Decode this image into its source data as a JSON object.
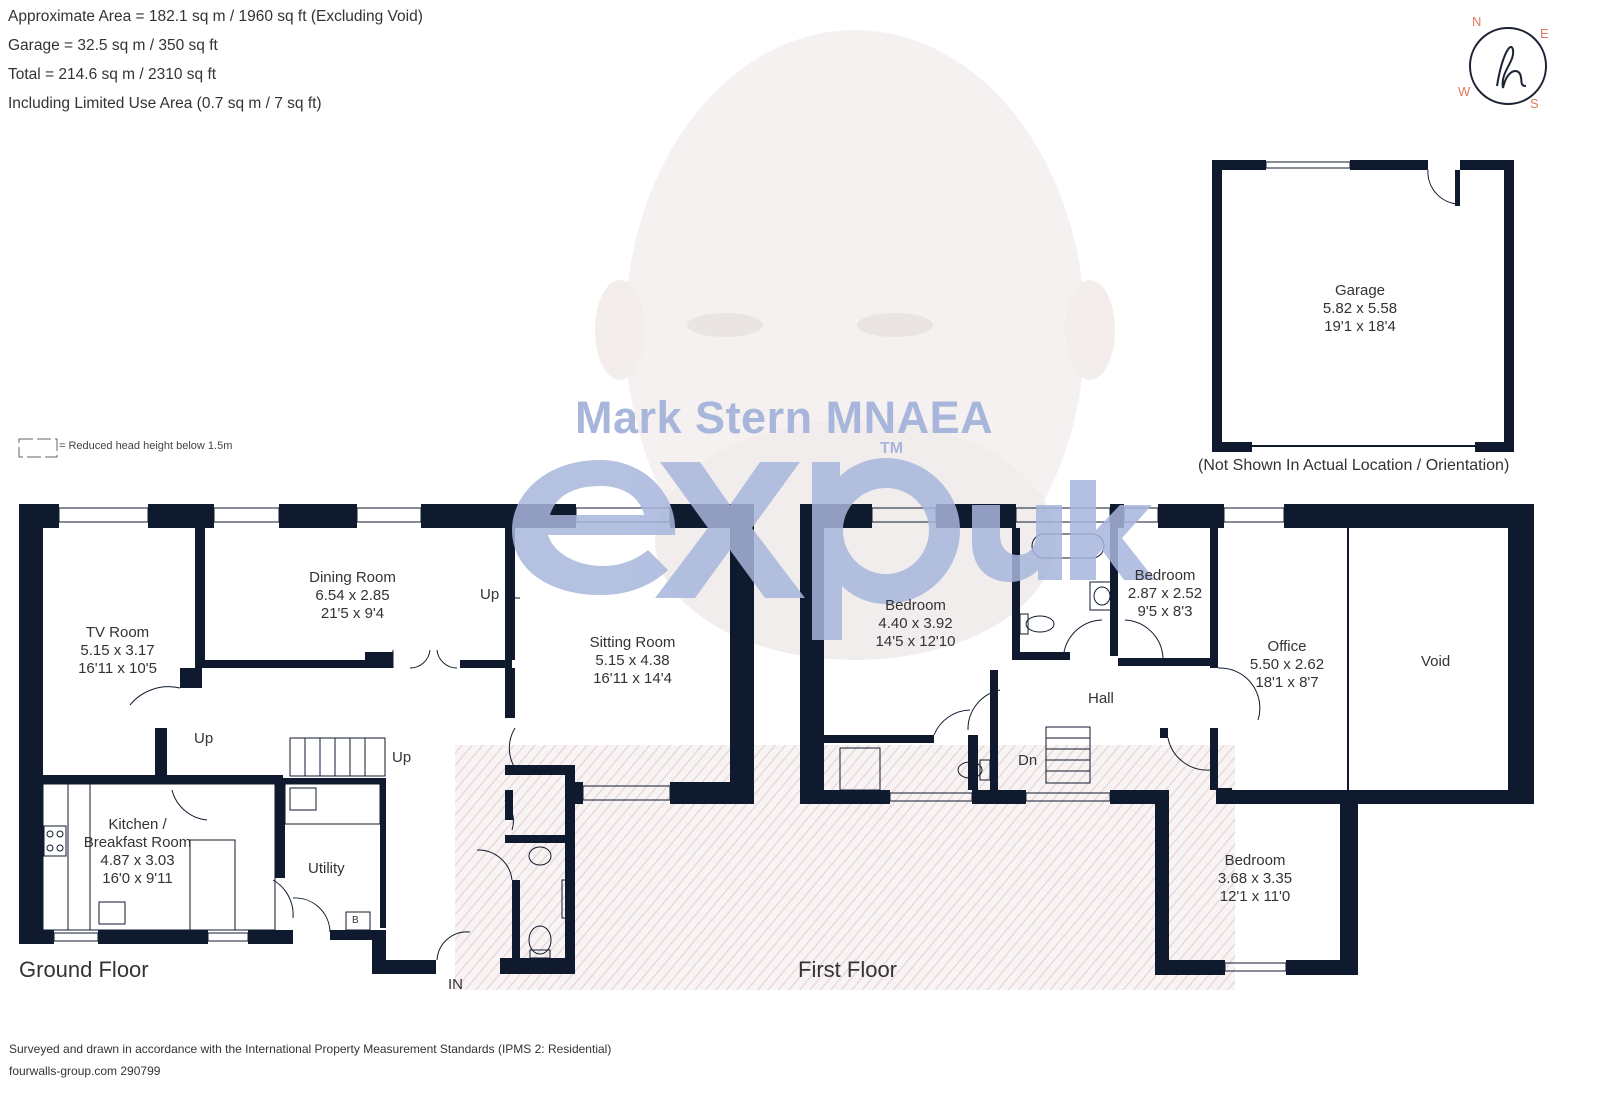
{
  "header": {
    "line1": "Approximate Area = 182.1 sq m / 1960 sq ft (Excluding Void)",
    "line2": "Garage = 32.5 sq m / 350 sq ft",
    "line3": "Total = 214.6 sq m / 2310 sq ft",
    "line4": "Including Limited Use Area (0.7 sq m / 7 sq ft)"
  },
  "compass": {
    "n": "N",
    "e": "E",
    "s": "S",
    "w": "W",
    "logo": "h",
    "color": "#e07a5f"
  },
  "legend": {
    "text": "= Reduced head height below 1.5m"
  },
  "watermark": {
    "name": "Mark Stern MNAEA",
    "brand": "exp",
    "region": "uk",
    "tm": "TM",
    "color": "#a8b6dc"
  },
  "garage": {
    "name": "Garage",
    "metric": "5.82 x 5.58",
    "imperial": "19'1 x 18'4",
    "note": "(Not Shown In Actual Location / Orientation)"
  },
  "ground_floor": {
    "label": "Ground Floor",
    "rooms": [
      {
        "name": "TV Room",
        "metric": "5.15 x 3.17",
        "imperial": "16'11 x 10'5"
      },
      {
        "name": "Dining Room",
        "metric": "6.54 x 2.85",
        "imperial": "21'5 x 9'4"
      },
      {
        "name": "Sitting Room",
        "metric": "5.15 x 4.38",
        "imperial": "16'11 x 14'4"
      },
      {
        "name": "Kitchen /",
        "name2": "Breakfast Room",
        "metric": "4.87 x 3.03",
        "imperial": "16'0 x 9'11"
      },
      {
        "name": "Utility"
      }
    ],
    "labels": {
      "up1": "Up",
      "up2": "Up",
      "up3": "Up",
      "entrance": "IN",
      "boiler": "B"
    }
  },
  "first_floor": {
    "label": "First Floor",
    "rooms": [
      {
        "name": "Bedroom",
        "metric": "4.40 x 3.92",
        "imperial": "14'5 x 12'10"
      },
      {
        "name": "Bedroom",
        "metric": "2.87 x 2.52",
        "imperial": "9'5 x 8'3"
      },
      {
        "name": "Office",
        "metric": "5.50 x 2.62",
        "imperial": "18'1 x 8'7"
      },
      {
        "name": "Void"
      },
      {
        "name": "Hall"
      },
      {
        "name": "Bedroom",
        "metric": "3.68 x 3.35",
        "imperial": "12'1 x 11'0"
      }
    ],
    "labels": {
      "down": "Dn"
    }
  },
  "footer": {
    "line1": "Surveyed and drawn in accordance with the International Property Measurement Standards (IPMS 2: Residential)",
    "line2": "fourwalls-group.com 290799"
  },
  "colors": {
    "wall": "#0f1a2e",
    "text": "#333333",
    "accent": "#e07a5f",
    "watermark": "#a8b6dc"
  }
}
